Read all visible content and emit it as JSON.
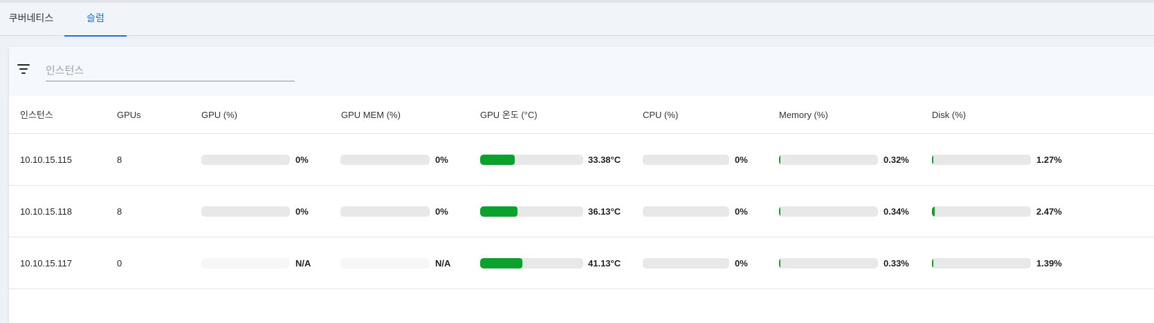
{
  "tabs": [
    "쿠버네티스",
    "슬럼"
  ],
  "active_tab_index": 1,
  "filter": {
    "placeholder": "인스턴스",
    "value": ""
  },
  "columns": [
    "인스턴스",
    "GPUs",
    "GPU (%)",
    "GPU MEM (%)",
    "GPU 온도 (°C)",
    "CPU (%)",
    "Memory (%)",
    "Disk (%)"
  ],
  "accent_color": "#1a73c9",
  "bar_fill_color": "#0aa12c",
  "rows": [
    {
      "instance": "10.10.15.115",
      "gpus": "8",
      "gpu_label": "0%",
      "gpu_fraction": 0,
      "gpu_mem_label": "0%",
      "gpu_mem_fraction": 0,
      "gpu_temp_label": "33.38°C",
      "gpu_temp_fraction": 0.3338,
      "cpu_label": "0%",
      "cpu_fraction": 0,
      "memory_label": "0.32%",
      "memory_fraction": 0.0032,
      "disk_label": "1.27%",
      "disk_fraction": 0.0127
    },
    {
      "instance": "10.10.15.118",
      "gpus": "8",
      "gpu_label": "0%",
      "gpu_fraction": 0,
      "gpu_mem_label": "0%",
      "gpu_mem_fraction": 0,
      "gpu_temp_label": "36.13°C",
      "gpu_temp_fraction": 0.3613,
      "cpu_label": "0%",
      "cpu_fraction": 0,
      "memory_label": "0.34%",
      "memory_fraction": 0.0034,
      "disk_label": "2.47%",
      "disk_fraction": 0.0247
    },
    {
      "instance": "10.10.15.117",
      "gpus": "0",
      "gpu_label": "N/A",
      "gpu_fraction": null,
      "gpu_mem_label": "N/A",
      "gpu_mem_fraction": null,
      "gpu_temp_label": "41.13°C",
      "gpu_temp_fraction": 0.4113,
      "cpu_label": "0%",
      "cpu_fraction": 0,
      "memory_label": "0.33%",
      "memory_fraction": 0.0033,
      "disk_label": "1.39%",
      "disk_fraction": 0.0139
    }
  ]
}
